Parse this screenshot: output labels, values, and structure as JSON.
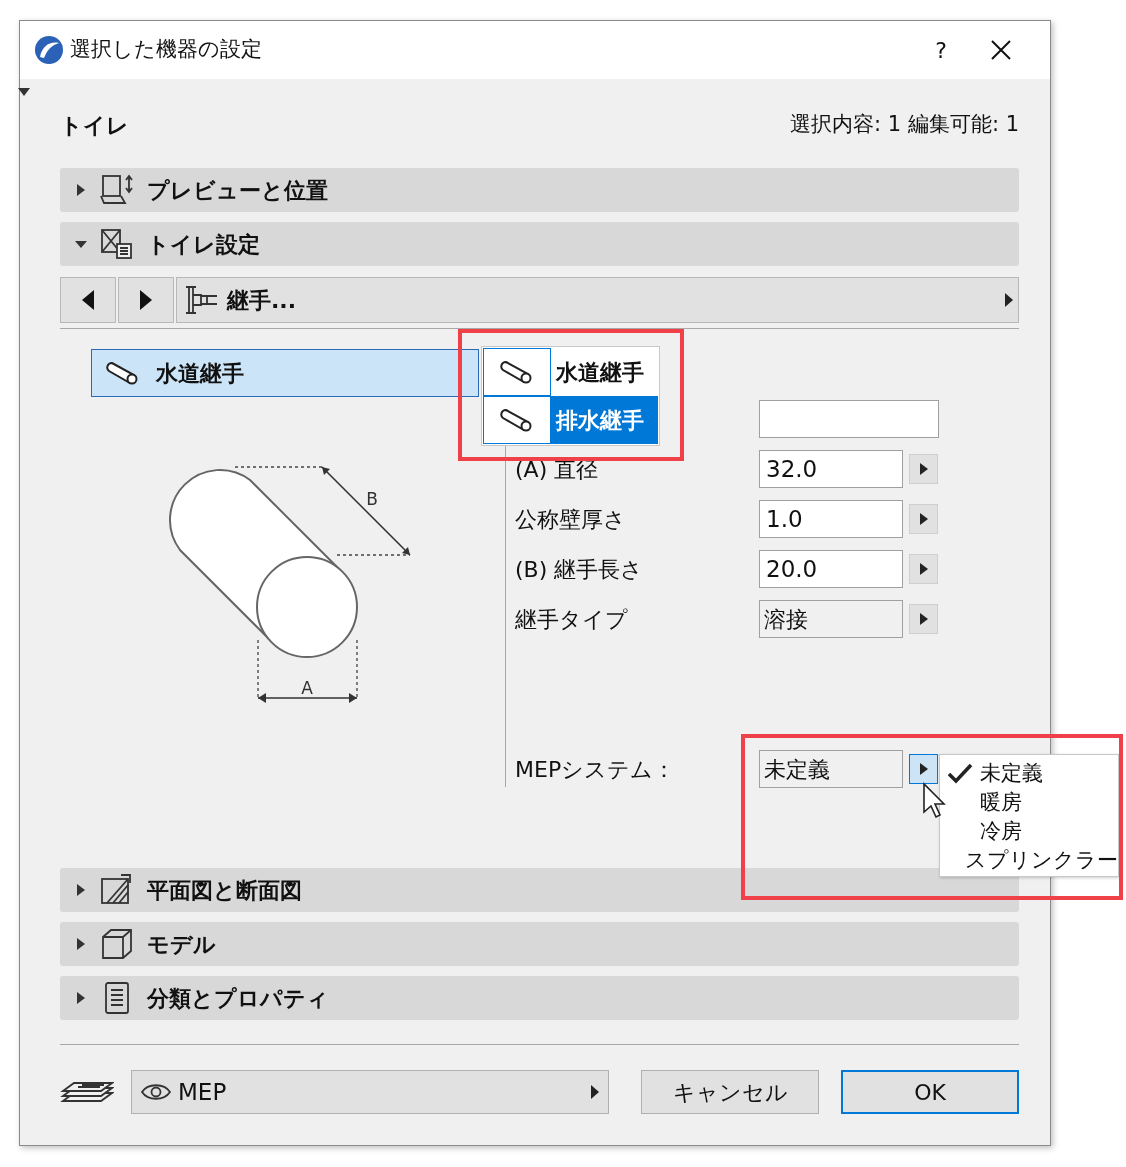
{
  "window": {
    "title": "選択した機器の設定",
    "help": "?"
  },
  "header": {
    "element": "トイレ",
    "selection_info": "選択内容: 1 編集可能: 1"
  },
  "sections_top": [
    {
      "label": "プレビューと位置",
      "expanded": false
    },
    {
      "label": "トイレ設定",
      "expanded": true
    }
  ],
  "page_nav": {
    "label": "継手..."
  },
  "joint_list": {
    "label": "水道継手",
    "selected": true
  },
  "joint_menu": [
    {
      "label": "水道継手",
      "selected": false
    },
    {
      "label": "排水継手",
      "selected": true
    }
  ],
  "drawing_labels": {
    "length": "B",
    "diameter": "A"
  },
  "parameters": [
    {
      "label": "(A) 直径",
      "value": "32.0",
      "kind": "number"
    },
    {
      "label": "公称壁厚さ",
      "value": "1.0",
      "kind": "number"
    },
    {
      "label": "(B) 継手長さ",
      "value": "20.0",
      "kind": "number"
    },
    {
      "label": "継手タイプ",
      "value": "溶接",
      "kind": "choice"
    }
  ],
  "mep_system": {
    "label": "MEPシステム：",
    "value": "未定義"
  },
  "mep_menu": [
    {
      "label": "未定義",
      "checked": true
    },
    {
      "label": "暖房",
      "checked": false
    },
    {
      "label": "冷房",
      "checked": false
    },
    {
      "label": "スプリンクラー",
      "checked": false
    }
  ],
  "sections_bottom": [
    {
      "label": "平面図と断面図",
      "expanded": false
    },
    {
      "label": "モデル",
      "expanded": false
    },
    {
      "label": "分類とプロパティ",
      "expanded": false
    }
  ],
  "footer": {
    "layer": "MEP",
    "cancel": "キャンセル",
    "ok": "OK"
  }
}
